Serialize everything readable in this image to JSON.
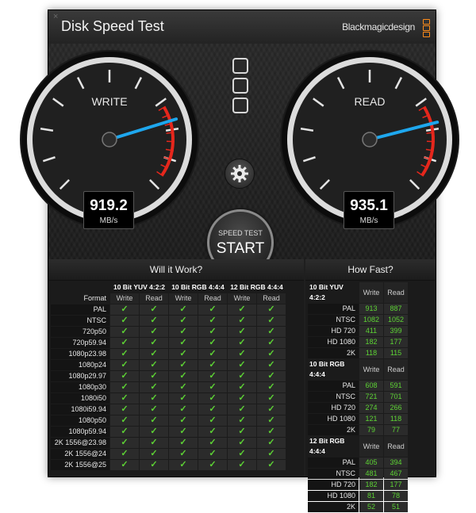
{
  "window": {
    "title": "Disk Speed Test",
    "brand": "Blackmagicdesign",
    "close_glyph": "×"
  },
  "gauges": {
    "write": {
      "label": "WRITE",
      "value": "919.2",
      "unit": "MB/s",
      "needle_fraction": 0.77
    },
    "read": {
      "label": "READ",
      "value": "935.1",
      "unit": "MB/s",
      "needle_fraction": 0.78
    }
  },
  "start_button": {
    "small_label": "SPEED TEST",
    "big_label": "START"
  },
  "icons": {
    "settings": "gear-icon",
    "disk": "disk-slot-icon",
    "check": "✓"
  },
  "colors": {
    "needle": "#1ea7ee",
    "check": "#5dd334",
    "redzone": "#e6271c",
    "brand_logo": "#ff8c1a"
  },
  "will_it_work": {
    "title": "Will it Work?",
    "format_label": "Format",
    "groups": [
      "10 Bit YUV 4:2:2",
      "10 Bit RGB 4:4:4",
      "12 Bit RGB 4:4:4"
    ],
    "sub_headers": [
      "Write",
      "Read",
      "Write",
      "Read",
      "Write",
      "Read"
    ],
    "formats": [
      "PAL",
      "NTSC",
      "720p50",
      "720p59.94",
      "1080p23.98",
      "1080p24",
      "1080p29.97",
      "1080p30",
      "1080i50",
      "1080i59.94",
      "1080p50",
      "1080p59.94",
      "2K 1556@23.98",
      "2K 1556@24",
      "2K 1556@25"
    ]
  },
  "how_fast": {
    "title": "How Fast?",
    "sub_headers": [
      "Write",
      "Read"
    ],
    "groups": [
      {
        "name": "10 Bit YUV 4:2:2",
        "rows": [
          {
            "format": "PAL",
            "write": "913",
            "read": "887"
          },
          {
            "format": "NTSC",
            "write": "1082",
            "read": "1052"
          },
          {
            "format": "HD 720",
            "write": "411",
            "read": "399"
          },
          {
            "format": "HD 1080",
            "write": "182",
            "read": "177"
          },
          {
            "format": "2K",
            "write": "118",
            "read": "115"
          }
        ]
      },
      {
        "name": "10 Bit RGB 4:4:4",
        "rows": [
          {
            "format": "PAL",
            "write": "608",
            "read": "591"
          },
          {
            "format": "NTSC",
            "write": "721",
            "read": "701"
          },
          {
            "format": "HD 720",
            "write": "274",
            "read": "266"
          },
          {
            "format": "HD 1080",
            "write": "121",
            "read": "118"
          },
          {
            "format": "2K",
            "write": "79",
            "read": "77"
          }
        ]
      },
      {
        "name": "12 Bit RGB 4:4:4",
        "rows": [
          {
            "format": "PAL",
            "write": "405",
            "read": "394"
          },
          {
            "format": "NTSC",
            "write": "481",
            "read": "467"
          },
          {
            "format": "HD 720",
            "write": "182",
            "read": "177"
          },
          {
            "format": "HD 1080",
            "write": "81",
            "read": "78"
          },
          {
            "format": "2K",
            "write": "52",
            "read": "51"
          }
        ]
      }
    ]
  }
}
